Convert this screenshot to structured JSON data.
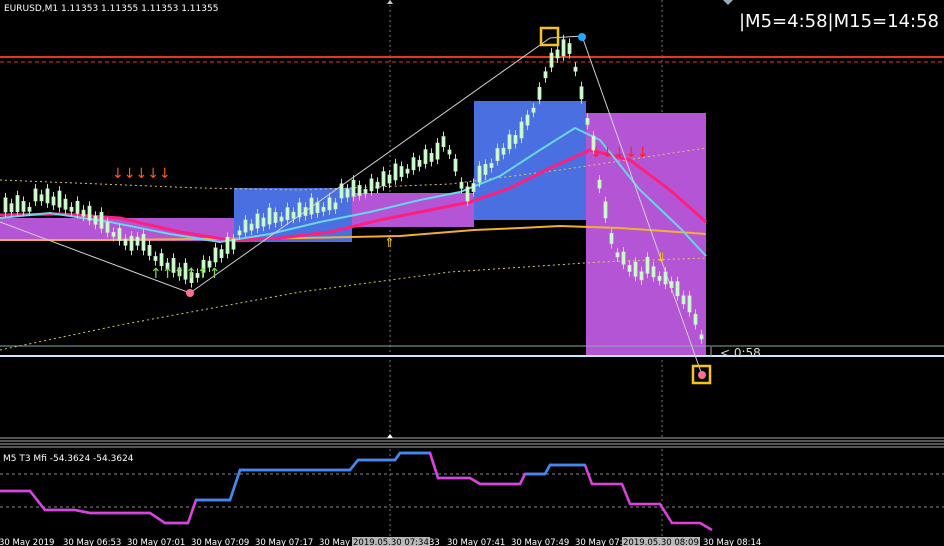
{
  "header": {
    "symbol_line": "EURUSD,M1  1.11353 1.11355 1.11353 1.11355",
    "timer": "|M5=4:58|M15=14:58"
  },
  "chart": {
    "countdown": "< 0:58",
    "up_arrows_glyph": "↑↑↑↑↑↑",
    "down_arrows_glyph": "↓↓↓↓↓"
  },
  "indicator": {
    "label": "M5  T3 Mfi  -54.3624 -54.3624"
  },
  "time_axis": {
    "labels": [
      "30 May 2019",
      "30 May 06:53",
      "30 May 07:01",
      "30 May 07:09",
      "30 May 07:17",
      "30 May",
      "2019.05.30 07:34",
      "33",
      "30 May 07:41",
      "30 May 07:49",
      "30 May 07:",
      "2019.05.30 08:09",
      "30 May 08:14"
    ]
  },
  "colors": {
    "background": "#000000",
    "bull_candle": "#ccffcc",
    "bear_candle": "#c8f0c8",
    "resistance": "#e8361c",
    "support": "#c8e6ff",
    "zone_blue": "#4a6fe0",
    "zone_magenta": "#b455d6",
    "ma_pink": "#ff1f7f",
    "ma_cyan": "#66d6e8",
    "ma_orange": "#f0b030",
    "mfi_blue": "#3a8cf0",
    "mfi_magenta": "#e040e0",
    "marker_yellow": "#f5c518"
  }
}
